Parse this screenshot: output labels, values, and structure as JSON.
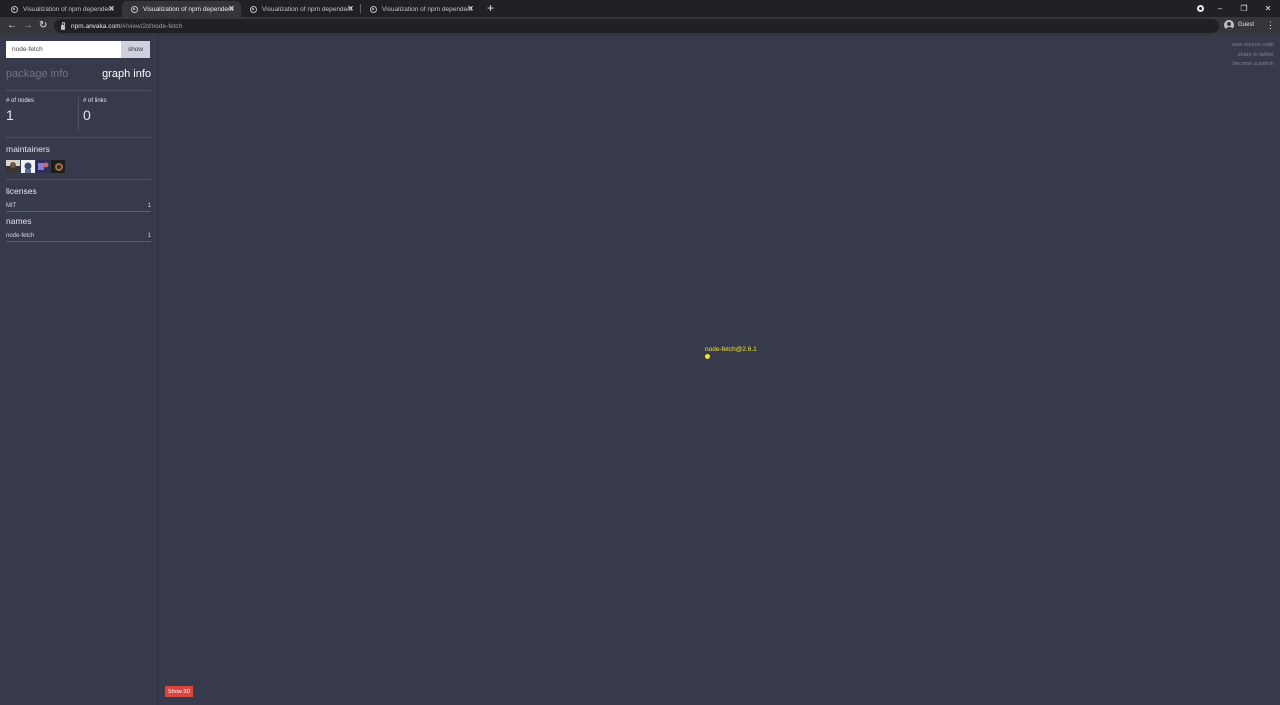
{
  "browser": {
    "tabs": [
      {
        "title": "Visualization of npm dependencies",
        "active": false
      },
      {
        "title": "Visualization of npm dependencies",
        "active": true
      },
      {
        "title": "Visualization of npm dependencies",
        "active": false
      },
      {
        "title": "Visualization of npm dependencies",
        "active": false
      }
    ],
    "url_host": "npm.anvaka.com",
    "url_path": "/#/view/2d/node-fetch",
    "profile_label": "Guest"
  },
  "sidebar": {
    "search_value": "node-fetch",
    "search_button": "show",
    "tab_package": "package info",
    "tab_graph": "graph info",
    "nodes_label": "# of nodes",
    "nodes_value": "1",
    "links_label": "# of links",
    "links_value": "0",
    "maintainers_title": "maintainers",
    "licenses_title": "licenses",
    "licenses": [
      {
        "name": "MIT",
        "count": "1"
      }
    ],
    "names_title": "names",
    "names": [
      {
        "name": "node-fetch",
        "count": "1"
      }
    ]
  },
  "graph": {
    "node_label": "node-fetch@2.6.1",
    "node_color": "#f5e52e"
  },
  "links": {
    "view_source": "view source code",
    "share": "share to twitter",
    "patron": "become a patron"
  },
  "show3d_label": "Show 3D",
  "colors": {
    "background": "#363a4a",
    "accent_button": "#d9453f"
  }
}
